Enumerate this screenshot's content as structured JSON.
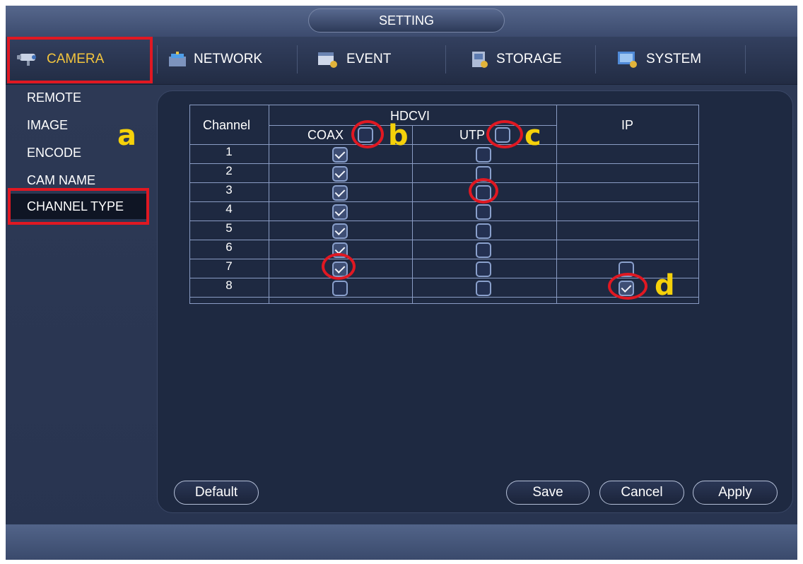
{
  "window": {
    "title": "SETTING"
  },
  "tabs": [
    {
      "label": "CAMERA",
      "icon": "camera-icon",
      "active": true
    },
    {
      "label": "NETWORK",
      "icon": "network-icon",
      "active": false
    },
    {
      "label": "EVENT",
      "icon": "event-icon",
      "active": false
    },
    {
      "label": "STORAGE",
      "icon": "storage-icon",
      "active": false
    },
    {
      "label": "SYSTEM",
      "icon": "system-icon",
      "active": false
    }
  ],
  "sidebar": {
    "items": [
      {
        "label": "REMOTE"
      },
      {
        "label": "IMAGE"
      },
      {
        "label": "ENCODE"
      },
      {
        "label": "CAM NAME"
      },
      {
        "label": "CHANNEL TYPE",
        "selected": true
      }
    ]
  },
  "annotations": {
    "a": "a",
    "b": "b",
    "c": "c",
    "d": "d"
  },
  "grid": {
    "channel_header": "Channel",
    "hdcvi_header": "HDCVI",
    "coax_header": "COAX",
    "utp_header": "UTP",
    "ip_header": "IP",
    "header_checkboxes": {
      "coax": false,
      "utp": false
    },
    "rows": [
      {
        "channel": "1",
        "coax": true,
        "utp": false
      },
      {
        "channel": "2",
        "coax": true,
        "utp": false
      },
      {
        "channel": "3",
        "coax": true,
        "utp": false
      },
      {
        "channel": "4",
        "coax": true,
        "utp": false
      },
      {
        "channel": "5",
        "coax": true,
        "utp": false
      },
      {
        "channel": "6",
        "coax": true,
        "utp": false
      },
      {
        "channel": "7",
        "coax": true,
        "utp": false,
        "ip": false
      },
      {
        "channel": "8",
        "coax": false,
        "utp": false,
        "ip": true
      }
    ]
  },
  "buttons": {
    "default_label": "Default",
    "save_label": "Save",
    "cancel_label": "Cancel",
    "apply_label": "Apply"
  },
  "colors": {
    "accent_active_tab": "#f3c53d",
    "annotation_red": "#e01822",
    "annotation_yellow": "#f5d10a"
  }
}
